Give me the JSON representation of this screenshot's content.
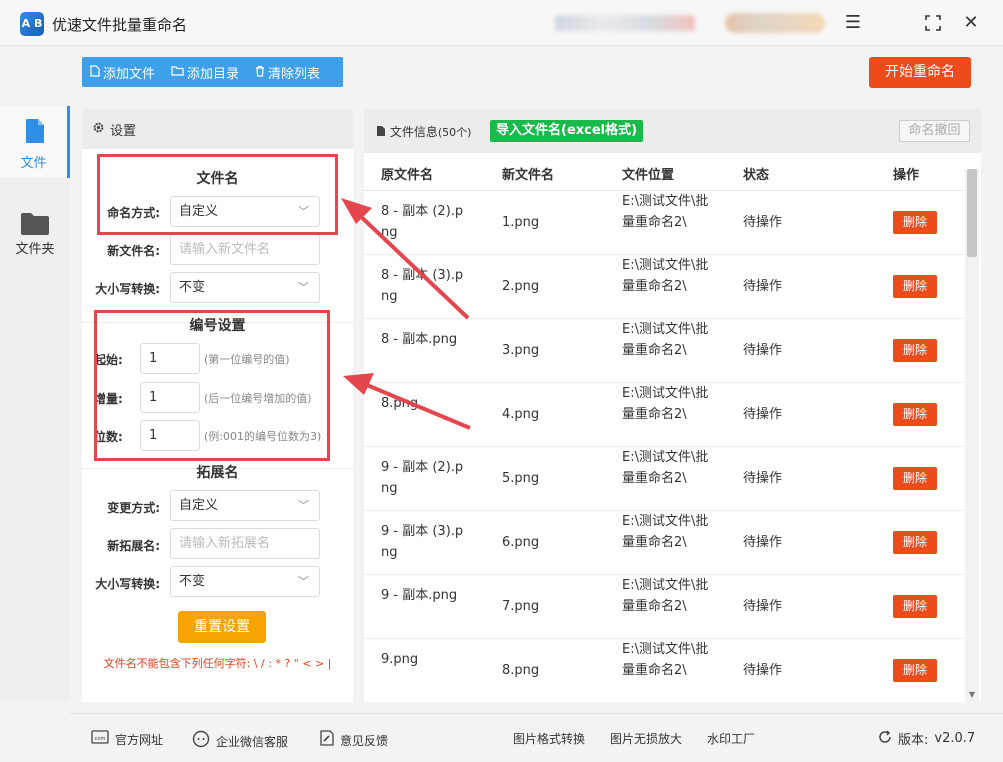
{
  "app": {
    "title": "优速文件批量重命名",
    "logo_text": "A B"
  },
  "toolbar": {
    "add_file": "添加文件",
    "add_folder": "添加目录",
    "clear_list": "清除列表",
    "start": "开始重命名"
  },
  "nav": [
    {
      "label": "文件",
      "icon": "file-icon",
      "active": true
    },
    {
      "label": "文件夹",
      "icon": "folder-icon",
      "active": false
    }
  ],
  "settings": {
    "header": "设置",
    "filename": {
      "title": "文件名",
      "mode_label": "命名方式:",
      "mode_value": "自定义",
      "newname_label": "新文件名:",
      "newname_placeholder": "请输入新文件名",
      "case_label": "大小写转换:",
      "case_value": "不变"
    },
    "numbering": {
      "title": "编号设置",
      "start_label": "起始:",
      "start_value": "1",
      "start_hint": "(第一位编号的值)",
      "step_label": "增量:",
      "step_value": "1",
      "step_hint": "(后一位编号增加的值)",
      "digits_label": "位数:",
      "digits_value": "1",
      "digits_hint": "(例:001的编号位数为3)"
    },
    "extension": {
      "title": "拓展名",
      "mode_label": "变更方式:",
      "mode_value": "自定义",
      "newext_label": "新拓展名:",
      "newext_placeholder": "请输入新拓展名",
      "case_label": "大小写转换:",
      "case_value": "不变"
    },
    "reset": "重置设置",
    "warning": "文件名不能包含下列任何字符: \\ / : * ? \" < > |"
  },
  "files": {
    "info": "文件信息",
    "count": "(50个)",
    "import": "导入文件名(excel格式)",
    "undo": "命名撤回",
    "columns": [
      "原文件名",
      "新文件名",
      "文件位置",
      "状态",
      "操作"
    ],
    "rows": [
      {
        "orig": "8 - 副本 (2).png",
        "new": "1.png",
        "path": "E:\\测试文件\\批量重命名2\\",
        "status": "待操作",
        "action": "删除"
      },
      {
        "orig": "8 - 副本 (3).png",
        "new": "2.png",
        "path": "E:\\测试文件\\批量重命名2\\",
        "status": "待操作",
        "action": "删除"
      },
      {
        "orig": "8 - 副本.png",
        "new": "3.png",
        "path": "E:\\测试文件\\批量重命名2\\",
        "status": "待操作",
        "action": "删除"
      },
      {
        "orig": "8.png",
        "new": "4.png",
        "path": "E:\\测试文件\\批量重命名2\\",
        "status": "待操作",
        "action": "删除"
      },
      {
        "orig": "9 - 副本 (2).png",
        "new": "5.png",
        "path": "E:\\测试文件\\批量重命名2\\",
        "status": "待操作",
        "action": "删除"
      },
      {
        "orig": "9 - 副本 (3).png",
        "new": "6.png",
        "path": "E:\\测试文件\\批量重命名2\\",
        "status": "待操作",
        "action": "删除"
      },
      {
        "orig": "9 - 副本.png",
        "new": "7.png",
        "path": "E:\\测试文件\\批量重命名2\\",
        "status": "待操作",
        "action": "删除"
      },
      {
        "orig": "9.png",
        "new": "8.png",
        "path": "E:\\测试文件\\批量重命名2\\",
        "status": "待操作",
        "action": "删除"
      }
    ]
  },
  "footer": {
    "website": "官方网址",
    "wechat": "企业微信客服",
    "feedback": "意见反馈",
    "img_convert": "图片格式转换",
    "img_enlarge": "图片无损放大",
    "watermark": "水印工厂",
    "version_label": "版本:",
    "version": "v2.0.7"
  },
  "colors": {
    "accent": "#3ea0e8",
    "start": "#ee4b1c",
    "import": "#19b94b",
    "reset": "#f7a400",
    "highlight": "#e5464e"
  }
}
